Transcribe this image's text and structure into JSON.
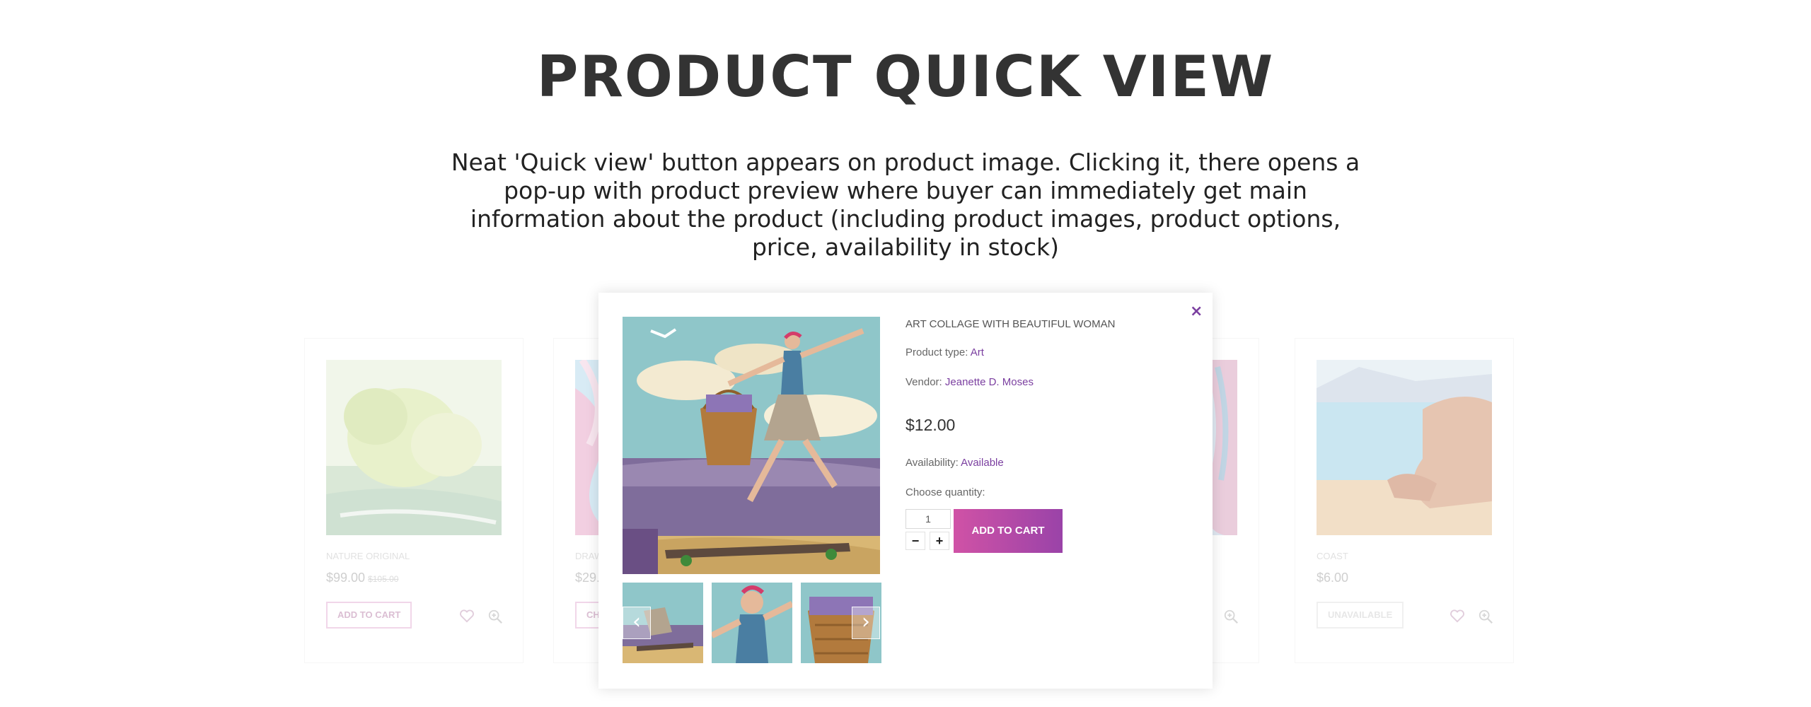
{
  "hero": {
    "title": "PRODUCT QUICK VIEW",
    "description": "Neat 'Quick view' button appears on product image. Clicking it, there opens a pop-up with product preview where buyer can immediately get main information about the product (including product images, product options, price, availability in stock)"
  },
  "products": [
    {
      "name": "NATURE ORIGINAL",
      "price": "$99.00",
      "old_price": "$105.00",
      "button": "ADD TO CART"
    },
    {
      "name": "DRAW",
      "price": "$29.",
      "old_price": "",
      "button": "CHO"
    },
    {
      "name": "",
      "price": "",
      "old_price": "",
      "button": ""
    },
    {
      "name": "COAST",
      "price": "$6.00",
      "old_price": "",
      "button": "UNAVAILABLE"
    }
  ],
  "modal": {
    "close_label": "×",
    "title": "ART COLLAGE WITH BEAUTIFUL WOMAN",
    "product_type_label": "Product type:",
    "product_type_value": "Art",
    "vendor_label": "Vendor:",
    "vendor_value": "Jeanette D. Moses",
    "price": "$12.00",
    "availability_label": "Availability:",
    "availability_value": "Available",
    "quantity_label": "Choose quantity:",
    "quantity_value": "1",
    "minus_label": "−",
    "plus_label": "+",
    "add_to_cart": "ADD TO CART",
    "prev_arrow": "‹",
    "next_arrow": "›"
  },
  "colors": {
    "accent": "#7b3fa0",
    "button_gradient_start": "#d052a6",
    "button_gradient_end": "#9a43a8"
  }
}
